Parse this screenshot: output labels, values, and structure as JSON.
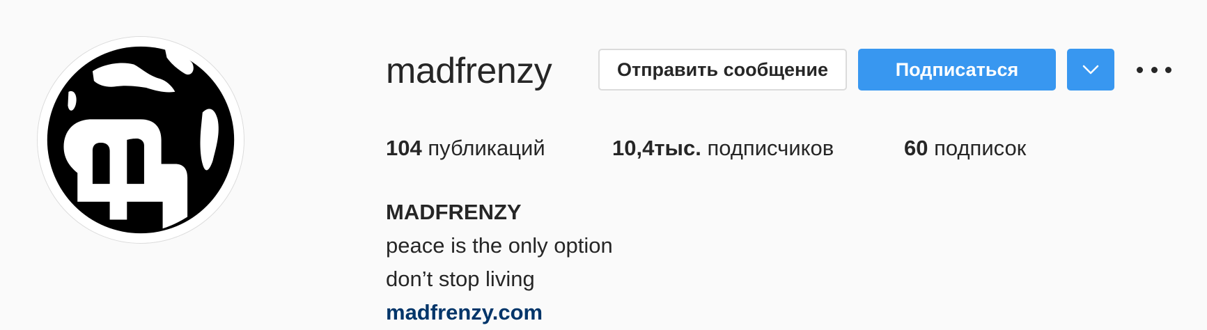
{
  "profile": {
    "username": "madfrenzy",
    "avatar_alt": "avatar",
    "buttons": {
      "message": "Отправить сообщение",
      "follow": "Подписаться",
      "chevron_icon": "chevron-down-icon",
      "more_icon": "more-horizontal-icon"
    },
    "stats": {
      "posts_count": "104",
      "posts_label": "публикаций",
      "followers_count": "10,4тыс.",
      "followers_label": "подписчиков",
      "following_count": "60",
      "following_label": "подписок"
    },
    "bio": {
      "name": "MADFRENZY",
      "line1": "peace is the only option",
      "line2": "don’t stop living",
      "link": "madfrenzy.com"
    }
  },
  "colors": {
    "background": "#fafafa",
    "primary_button": "#3897f0",
    "link": "#003569",
    "text": "#262626",
    "border": "#dbdbdb"
  }
}
